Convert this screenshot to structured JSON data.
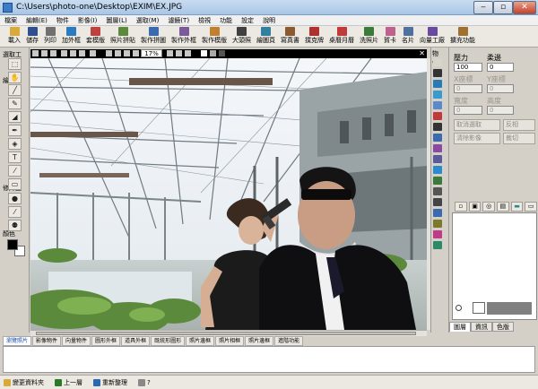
{
  "window": {
    "title": "C:\\Users\\photo-one\\Desktop\\EXIM\\EX.JPG",
    "min_glyph": "‒",
    "max_glyph": "▫",
    "close_glyph": "✕"
  },
  "menu": [
    "檔案",
    "編輯(E)",
    "物件",
    "影像(I)",
    "圖層(L)",
    "選取(M)",
    "濾鏡(T)",
    "檢視",
    "功能",
    "設定",
    "說明"
  ],
  "toolbar": [
    {
      "label": "載入",
      "icon": "folder-open-icon",
      "color": "#d9a93a"
    },
    {
      "label": "儲存",
      "icon": "save-icon",
      "color": "#2f4f8f"
    },
    {
      "label": "列印",
      "icon": "print-icon",
      "color": "#707070"
    },
    {
      "label": "加外框",
      "icon": "frame-icon",
      "color": "#2b7bc0"
    },
    {
      "label": "套模版",
      "icon": "template-icon",
      "color": "#c04040"
    },
    {
      "label": "照片拼貼",
      "icon": "collage-icon",
      "color": "#5a8a3a"
    },
    {
      "label": "製作拼圖",
      "icon": "puzzle-icon",
      "color": "#3a6ab0"
    },
    {
      "label": "製作外框",
      "icon": "make-frame-icon",
      "color": "#7a5a9a"
    },
    {
      "label": "製作模版",
      "icon": "make-template-icon",
      "color": "#c08030"
    },
    {
      "label": "大頭照",
      "icon": "portrait-icon",
      "color": "#404040"
    },
    {
      "label": "繪圖頁",
      "icon": "drawing-icon",
      "color": "#3080a0"
    },
    {
      "label": "寫真書",
      "icon": "photobook-icon",
      "color": "#8a5a30"
    },
    {
      "label": "撲克牌",
      "icon": "cards-icon",
      "color": "#b03030"
    },
    {
      "label": "桌曆月曆",
      "icon": "calendar-icon",
      "color": "#c03a3a"
    },
    {
      "label": "洗照片",
      "icon": "print-photo-icon",
      "color": "#3a7a3a"
    },
    {
      "label": "賀卡",
      "icon": "greeting-card-icon",
      "color": "#c06090"
    },
    {
      "label": "名片",
      "icon": "business-card-icon",
      "color": "#5070a0"
    },
    {
      "label": "向量工廠",
      "icon": "vector-icon",
      "color": "#6a4aa0"
    },
    {
      "label": "擴充功能",
      "icon": "extension-icon",
      "color": "#a07030"
    }
  ],
  "left_panel": {
    "select_label": "選取工",
    "draw_label": "繪圖工",
    "retouch_label": "修片工",
    "color_label": "顏色",
    "select_tools": [
      {
        "glyph": "⬚",
        "name": "rect-select-icon"
      },
      {
        "glyph": "✋",
        "name": "hand-icon"
      }
    ],
    "draw_tools": [
      {
        "glyph": "╱",
        "name": "line-icon"
      },
      {
        "glyph": "✎",
        "name": "pencil-icon"
      },
      {
        "glyph": "◢",
        "name": "eraser-icon"
      },
      {
        "glyph": "✒",
        "name": "pen-icon"
      },
      {
        "glyph": "◈",
        "name": "fill-icon"
      },
      {
        "glyph": "T",
        "name": "text-icon"
      },
      {
        "glyph": "⁄",
        "name": "eyedropper-icon"
      },
      {
        "glyph": "▭",
        "name": "shape-icon"
      }
    ],
    "retouch_tools": [
      {
        "glyph": "●",
        "name": "red-eye-icon"
      },
      {
        "glyph": "⁄",
        "name": "brush-icon"
      },
      {
        "glyph": "⚉",
        "name": "clone-icon"
      }
    ]
  },
  "image_strip": {
    "zoom": "17%",
    "close_glyph": "✕"
  },
  "right_icons": {
    "label": "物件"
  },
  "props": {
    "pressure_label": "壓力",
    "pressure_value": "100",
    "softness_label": "柔邊",
    "softness_value": "0",
    "x_label": "X座標",
    "x_value": "0",
    "y_label": "Y座標",
    "y_value": "0",
    "width_label": "寬度",
    "width_value": "0",
    "height_label": "高度",
    "height_value": "0",
    "cancel_select": "取消選取",
    "invert": "反相",
    "clear_image": "清除影像",
    "crop": "裁切",
    "tabs": [
      "圖層",
      "資訊",
      "色版"
    ]
  },
  "bottom_tabs": [
    "瀏覽照片",
    "影像物件",
    "向量物件",
    "圖形外框",
    "道具外框",
    "既統形圖形",
    "照片邊框",
    "照片相框",
    "照片邊框",
    "進階功能"
  ],
  "status": [
    "變更資料夾",
    "上一層",
    "重新整理",
    "?"
  ]
}
